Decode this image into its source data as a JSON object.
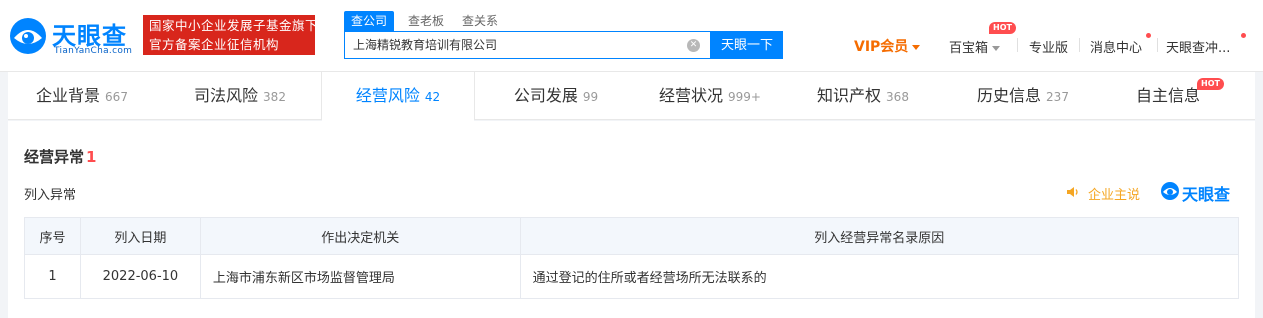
{
  "brand": {
    "name_cn": "天眼查",
    "name_en": "TianYanCha.com",
    "badge_line1": "国家中小企业发展子基金旗下",
    "badge_line2": "官方备案企业征信机构"
  },
  "search": {
    "tabs": [
      "查公司",
      "查老板",
      "查关系"
    ],
    "value": "上海精锐教育培训有限公司",
    "button": "天眼一下"
  },
  "top_nav": {
    "vip": "VIP会员",
    "treasure": "百宝箱",
    "hot": "HOT",
    "pro": "专业版",
    "messages": "消息中心",
    "user": "天眼查冲..."
  },
  "tabs": [
    {
      "label": "企业背景",
      "count": "667"
    },
    {
      "label": "司法风险",
      "count": "382"
    },
    {
      "label": "经营风险",
      "count": "42"
    },
    {
      "label": "公司发展",
      "count": "99"
    },
    {
      "label": "经营状况",
      "count": "999+"
    },
    {
      "label": "知识产权",
      "count": "368"
    },
    {
      "label": "历史信息",
      "count": "237"
    },
    {
      "label": "自主信息",
      "count": ""
    }
  ],
  "tab_hot": "HOT",
  "section": {
    "title": "经营异常",
    "count": "1",
    "subtitle": "列入异常",
    "speaker_text": "企业主说",
    "logo_text": "天眼查"
  },
  "table": {
    "headers": [
      "序号",
      "列入日期",
      "作出决定机关",
      "列入经营异常名录原因"
    ],
    "rows": [
      {
        "no": "1",
        "date": "2022-06-10",
        "authority": "上海市浦东新区市场监督管理局",
        "reason": "通过登记的住所或者经营场所无法联系的"
      }
    ]
  },
  "colors": {
    "brand_blue": "#0084ff",
    "badge_red": "#d8261c",
    "vip_orange": "#f56c00"
  }
}
